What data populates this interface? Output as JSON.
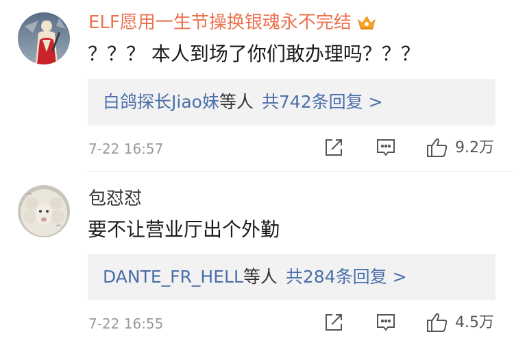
{
  "comments": [
    {
      "username": "ELF愿用一生节操换银魂永不完结",
      "text": "？？？ 本人到场了你们敢办理吗？？？",
      "reply_names": "白鸽探长Jiao妹",
      "reply_mid": "等人",
      "reply_count": "共742条回复 >",
      "time": "7-22 16:57",
      "likes": "9.2万",
      "badge_icon": "crown-badge-icon",
      "username_color": "#eb7350"
    },
    {
      "username": "包怼怼",
      "text": "要不让营业厅出个外勤",
      "reply_names": "DANTE_FR_HELL",
      "reply_mid": "等人",
      "reply_count": "共284条回复 >",
      "time": "7-22 16:55",
      "likes": "4.5万"
    }
  ],
  "colors": {
    "link": "#4a6ea9",
    "meta": "#9a9a9a",
    "reply_bg": "#f2f2f2"
  }
}
